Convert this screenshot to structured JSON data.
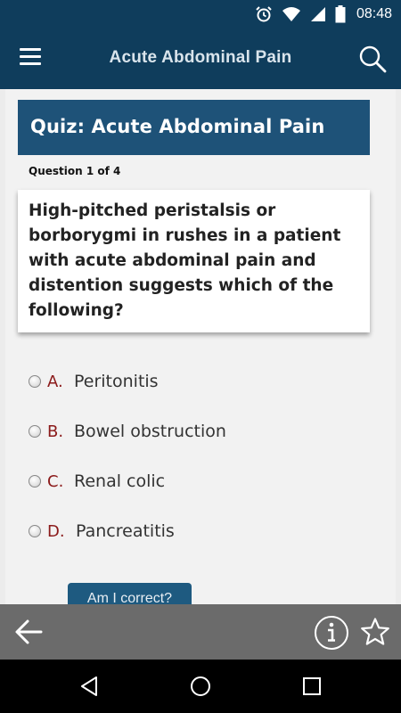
{
  "status_bar": {
    "time": "08:48",
    "icons": [
      "alarm-icon",
      "wifi-icon",
      "signal-icon",
      "battery-icon"
    ]
  },
  "app_bar": {
    "title": "Acute Abdominal Pain",
    "menu_icon": "hamburger-menu-icon",
    "search_icon": "search-icon"
  },
  "quiz": {
    "header": "Quiz: Acute Abdominal Pain",
    "question_count": "Question 1 of 4",
    "question": "High-pitched peristalsis or borborygmi in rushes in a patient with acute abdominal pain and distention suggests which of the following?",
    "options": [
      {
        "letter": "A.",
        "text": "Peritonitis"
      },
      {
        "letter": "B.",
        "text": "Bowel obstruction"
      },
      {
        "letter": "C.",
        "text": "Renal colic"
      },
      {
        "letter": "D.",
        "text": "Pancreatitis"
      }
    ],
    "check_button": "Am I correct?"
  },
  "toolbar": {
    "back_icon": "arrow-left-icon",
    "info_icon": "info-icon",
    "star_icon": "star-icon"
  },
  "colors": {
    "app_bar": "#0f3d5c",
    "quiz_header": "#1e5278",
    "option_letter": "#8b1a1a",
    "toolbar": "#6b6b6b"
  }
}
